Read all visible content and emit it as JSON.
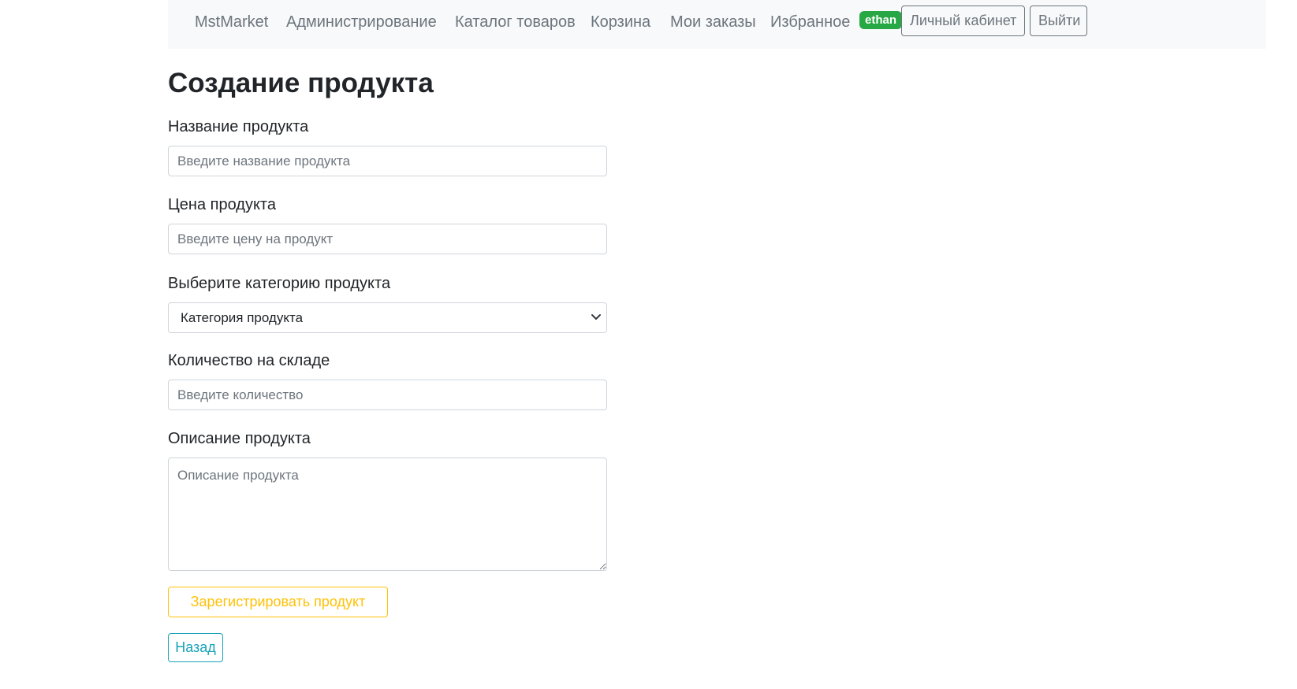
{
  "navbar": {
    "brand": "MstMarket",
    "links": [
      "Администрирование",
      "Каталог товаров",
      "Корзина",
      "Мои заказы",
      "Избранное"
    ],
    "user_badge": "ethan",
    "profile_button": "Личный кабинет",
    "logout_button": "Выйти"
  },
  "page": {
    "title": "Создание продукта"
  },
  "form": {
    "name_label": "Название продукта",
    "name_placeholder": "Введите название продукта",
    "price_label": "Цена продукта",
    "price_placeholder": "Введите цену на продукт",
    "category_label": "Выберите категорию продукта",
    "category_selected": "Категория продукта",
    "stock_label": "Количество на складе",
    "stock_placeholder": "Введите количество",
    "description_label": "Описание продукта",
    "description_placeholder": "Описание продукта",
    "submit_button": "Зарегистрировать продукт",
    "back_button": "Назад"
  },
  "colors": {
    "badge": "#28a745",
    "submit_outline": "#ffc107",
    "back_outline": "#17a2b8",
    "navbar_bg": "#f8f9fa"
  }
}
